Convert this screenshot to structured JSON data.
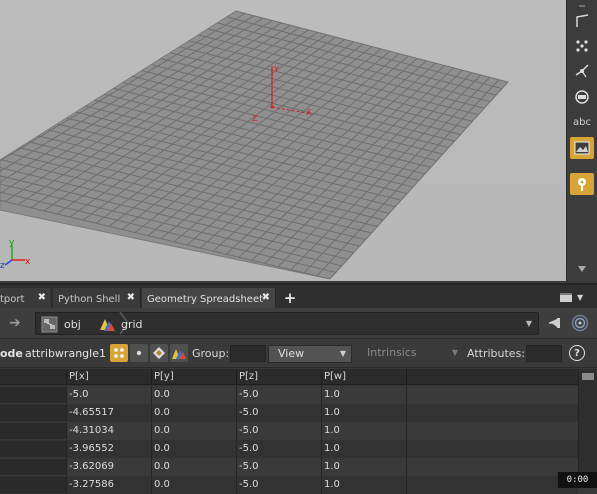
{
  "viewport": {
    "axis_labels": {
      "x": "x",
      "y": "y",
      "z": "z"
    },
    "toolbar_items": [
      {
        "name": "tool-bend",
        "icon": "angle-icon"
      },
      {
        "name": "tool-snap",
        "icon": "snap-grid-icon"
      },
      {
        "name": "tool-vector",
        "icon": "vector-icon"
      },
      {
        "name": "tool-sphere",
        "icon": "sphere-icon"
      },
      {
        "name": "tool-text",
        "label": "abc"
      },
      {
        "name": "tool-background",
        "icon": "image-icon",
        "active": true
      },
      {
        "name": "tool-pin",
        "icon": "pin-icon",
        "active": true
      }
    ]
  },
  "tabs": [
    {
      "label": "tport",
      "closable": true,
      "active": false
    },
    {
      "label": "Python Shell",
      "closable": true,
      "active": false
    },
    {
      "label": "Geometry Spreadsheet",
      "closable": true,
      "active": true
    }
  ],
  "tab_add_label": "+",
  "close_glyph": "✖",
  "path": {
    "crumbs": [
      {
        "label": "obj",
        "icon": "obj-network-icon"
      },
      {
        "label": "grid",
        "icon": "geometry-node-icon"
      }
    ]
  },
  "filter": {
    "node_label": "ode",
    "node_name": "attribwrangle1",
    "group_label": "Group:",
    "group_value": "",
    "view_select": "View",
    "intrinsics_select": "Intrinsics",
    "attributes_label": "Attributes:",
    "attributes_value": "",
    "help_label": "?"
  },
  "spreadsheet": {
    "columns": [
      "P[x]",
      "P[y]",
      "P[z]",
      "P[w]"
    ],
    "rows": [
      [
        "-5.0",
        "0.0",
        "-5.0",
        "1.0"
      ],
      [
        "-4.65517",
        "0.0",
        "-5.0",
        "1.0"
      ],
      [
        "-4.31034",
        "0.0",
        "-5.0",
        "1.0"
      ],
      [
        "-3.96552",
        "0.0",
        "-5.0",
        "1.0"
      ],
      [
        "-3.62069",
        "0.0",
        "-5.0",
        "1.0"
      ],
      [
        "-3.27586",
        "0.0",
        "-5.0",
        "1.0"
      ]
    ]
  },
  "timecode": "0:00",
  "colors": {
    "accent": "#d8a437",
    "grid_fill": "#8f8f8f",
    "grid_line": "#6e6e6e",
    "viewport_bg": "#bababa"
  }
}
